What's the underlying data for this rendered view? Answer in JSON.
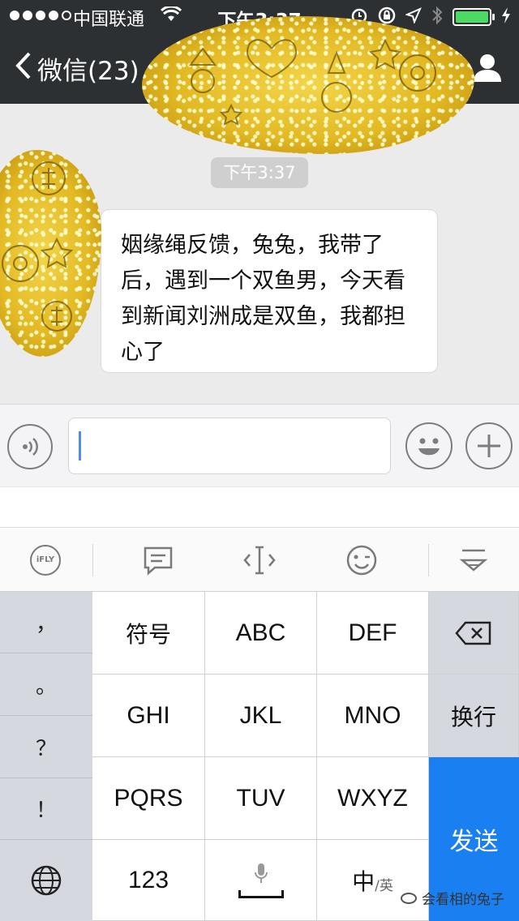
{
  "status": {
    "carrier": "中国联通",
    "time": "下午3:37",
    "battery_level": 1.0
  },
  "nav": {
    "back_label": "微信(23)"
  },
  "chat": {
    "timestamp": "下午3:37",
    "message": "姻缘绳反馈，兔兔，我带了后，遇到一个双鱼男，今天看到新闻刘洲成是双鱼，我都担心了"
  },
  "input": {
    "value": "",
    "placeholder": ""
  },
  "keyboard": {
    "toolbar_ifly": "iFLY",
    "left_keys": [
      "，",
      "。",
      "？",
      "！"
    ],
    "symbols": "符号",
    "abc": "ABC",
    "def": "DEF",
    "ghi": "GHI",
    "jkl": "JKL",
    "mno": "MNO",
    "newline": "换行",
    "pqrs": "PQRS",
    "tuv": "TUV",
    "wxyz": "WXYZ",
    "send": "发送",
    "num": "123",
    "lang_main": "中",
    "lang_sub": "/英"
  },
  "watermark": "会看相的兔子",
  "colors": {
    "nav_bg": "#2d3032",
    "send_key": "#1a7ff0",
    "battery": "#4cd964"
  }
}
